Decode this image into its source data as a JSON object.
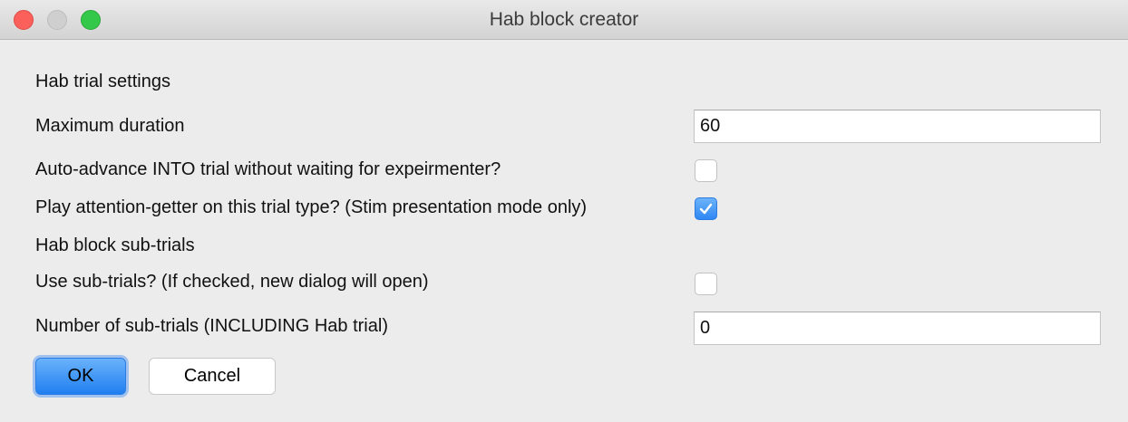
{
  "window": {
    "title": "Hab block creator"
  },
  "hab_trial": {
    "section_label": "Hab trial settings",
    "max_duration_label": "Maximum duration",
    "max_duration_value": "60",
    "auto_advance_label": "Auto-advance INTO trial without waiting for expeirmenter?",
    "auto_advance_checked": false,
    "attention_getter_label": "Play attention-getter on this trial type? (Stim presentation mode only)",
    "attention_getter_checked": true
  },
  "sub_trials": {
    "section_label": "Hab block sub-trials",
    "use_sub_trials_label": "Use sub-trials? (If checked, new dialog will open)",
    "use_sub_trials_checked": false,
    "count_label": "Number of sub-trials (INCLUDING Hab trial)",
    "count_value": "0"
  },
  "buttons": {
    "ok_label": "OK",
    "cancel_label": "Cancel"
  },
  "colors": {
    "accent": "#2f87f4",
    "close": "#fc605b",
    "maximize": "#34c84a"
  }
}
